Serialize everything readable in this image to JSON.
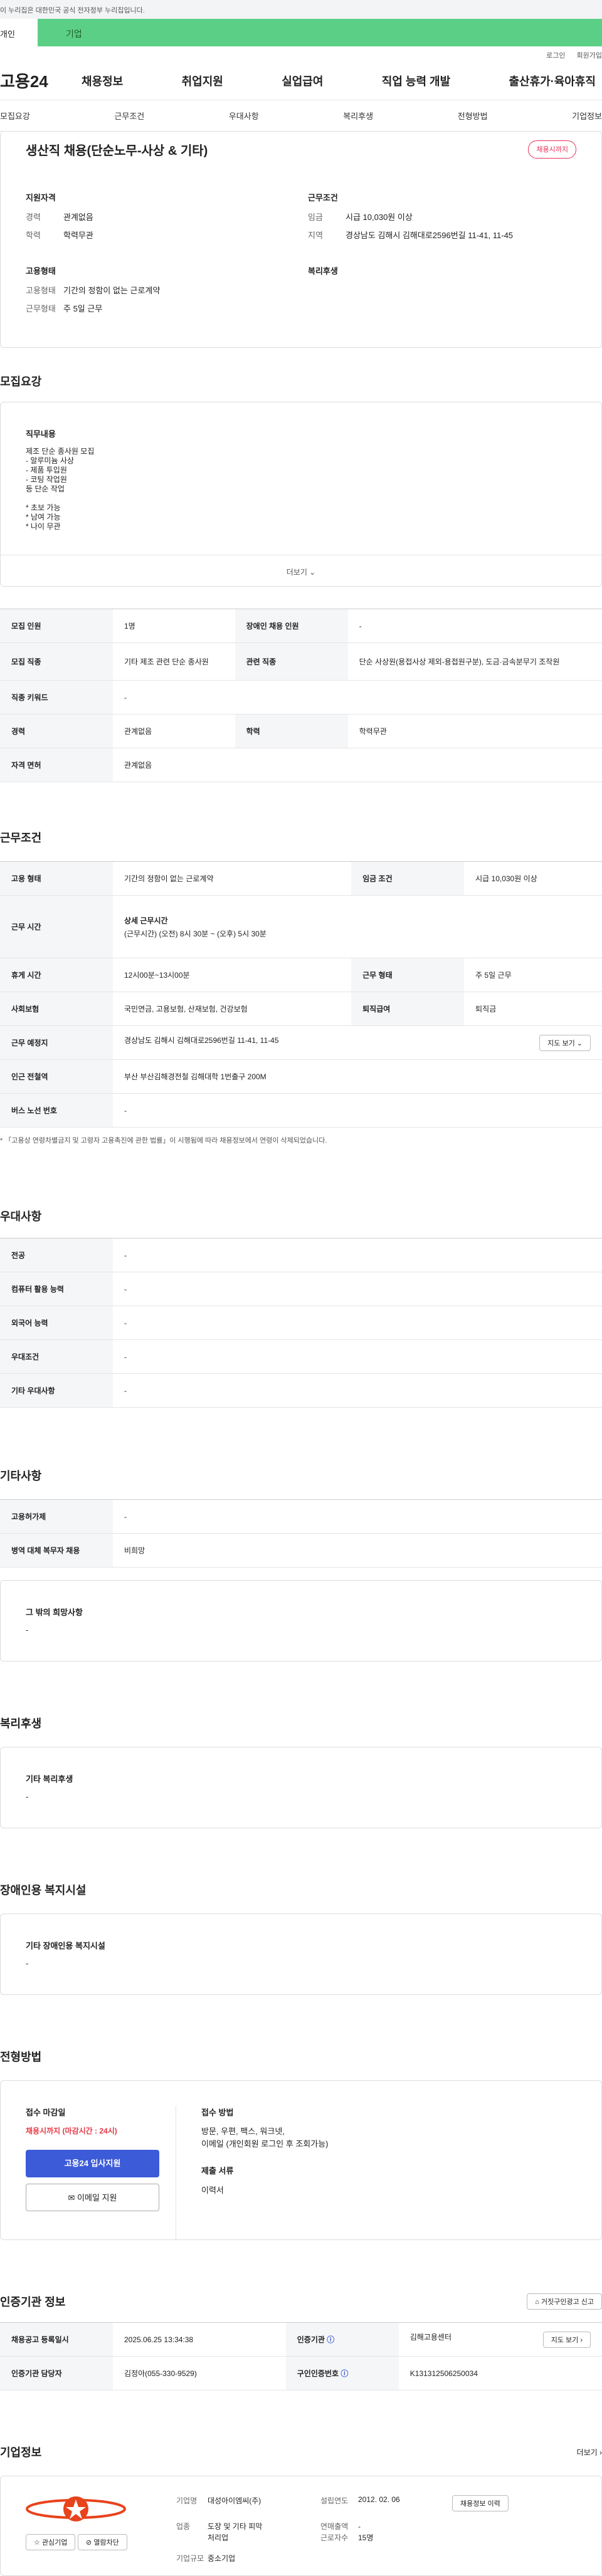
{
  "gov_banner": "이 누리집은 대한민국 공식 전자정부 누리집입니다.",
  "top_tabs": [
    "개인",
    "기업"
  ],
  "util": [
    "로그인",
    "회원가입"
  ],
  "logo": "고용24",
  "gnb": [
    "채용정보",
    "취업지원",
    "실업급여",
    "직업 능력 개발",
    "출산휴가·육아휴직"
  ],
  "subtabs": [
    "모집요강",
    "근무조건",
    "우대사항",
    "복리후생",
    "전형방법",
    "기업정보"
  ],
  "title": "생산직 채용(단순노무-사상 & 기타)",
  "status_badge": "채용시까지",
  "summary": {
    "qual_title": "지원자격",
    "career_k": "경력",
    "career_v": "관계없음",
    "edu_k": "학력",
    "edu_v": "학력무관",
    "cond_title": "근무조건",
    "wage_k": "임금",
    "wage_v": "시급 10,030원 이상",
    "region_k": "지역",
    "region_v": "경상남도 김해시 김해대로2596번길 11-41, 11-45",
    "emp_title": "고용형태",
    "emptype_k": "고용형태",
    "emptype_v": "기간의 정함이 없는 근로계약",
    "worktype_k": "근무형태",
    "worktype_v": "주 5일 근무",
    "welfare_title": "복리후생"
  },
  "recruit": {
    "heading": "모집요강",
    "duty_title": "직무내용",
    "duty_lines": [
      "제조 단순 종사원 모집",
      "- 알루미늄 사상",
      "- 제품 투입원",
      "- 코팅 작업원",
      "등 단순 작업",
      "",
      "* 초보 가능",
      "* 남여 가능",
      "* 나이 무관"
    ],
    "more": "더보기",
    "rows": [
      [
        "모집 인원",
        "1명",
        "장애인 채용 인원",
        "-"
      ],
      [
        "모집 직종",
        "기타 제조 관련 단순 종사원",
        "관련 직종",
        "단순 사상원(용접사상 제외-용접원구분), 도금·금속분무기 조작원"
      ],
      [
        "직종 키워드",
        "-"
      ],
      [
        "경력",
        "관계없음",
        "학력",
        "학력무관"
      ],
      [
        "자격 면허",
        "관계없음"
      ]
    ]
  },
  "condition": {
    "heading": "근무조건",
    "emptype_k": "고용 형태",
    "emptype_v": "기간의 정함이 없는 근로계약",
    "wagecond_k": "임금 조건",
    "wagecond_v": "시급 10,030원 이상",
    "worktime_k": "근무 시간",
    "worktime_title": "상세 근무시간",
    "worktime_v": "(근무시간) (오전) 8시 30분 ~ (오후) 5시 30분",
    "break_k": "휴게 시간",
    "break_v": "12시00분~13시00분",
    "form_k": "근무 형태",
    "form_v": "주 5일 근무",
    "ins_k": "사회보험",
    "ins_v": "국민연금, 고용보험, 산재보험, 건강보험",
    "sev_k": "퇴직급여",
    "sev_v": "퇴직금",
    "place_k": "근무 예정지",
    "place_v": "경상남도 김해시 김해대로2596번길 11-41, 11-45",
    "map_btn": "지도 보기",
    "subway_k": "인근 전철역",
    "subway_v": "부산 부산김해경전철 김해대학 1번출구 200M",
    "bus_k": "버스 노선 번호",
    "bus_v": "-",
    "note": "「고용상 연령차별금지 및 고령자 고용촉진에 관한 법률」이 시행됨에 따라 채용정보에서 연령이 삭제되었습니다."
  },
  "pref": {
    "heading": "우대사항",
    "rows": [
      [
        "전공",
        "-"
      ],
      [
        "컴퓨터 활용 능력",
        "-"
      ],
      [
        "외국어 능력",
        "-"
      ],
      [
        "우대조건",
        "-"
      ],
      [
        "기타 우대사항",
        "-"
      ]
    ]
  },
  "etc": {
    "heading": "기타사항",
    "rows": [
      [
        "고용허가제",
        "-"
      ],
      [
        "병역 대체 복무자 채용",
        "비희망"
      ]
    ],
    "box_title": "그 밖의 희망사항",
    "box_v": "-"
  },
  "welfare": {
    "heading": "복리후생",
    "box_title": "기타 복리후생",
    "box_v": "-"
  },
  "disabled": {
    "heading": "장애인용 복지시설",
    "box_title": "기타 장애인용 복지시설",
    "box_v": "-"
  },
  "process": {
    "heading": "전형방법",
    "deadline_title": "접수 마감일",
    "deadline_v": "채용시까지 (마감시간 : 24시)",
    "apply_btn": "고용24 입사지원",
    "email_btn": "이메일 지원",
    "method_title": "접수 방법",
    "method_v1": "방문, 우편, 팩스, 워크넷,",
    "method_v2": "이메일 (개인회원 로그인 후 조회가능)",
    "docs_title": "제출 서류",
    "docs_v": "이력서"
  },
  "agency": {
    "heading": "인증기관 정보",
    "report_btn": "거짓구인광고 신고",
    "reg_k": "채용공고 등록일시",
    "reg_v": "2025.06.25 13:34:38",
    "agency_k": "인증기관",
    "agency_v": "김해고용센터",
    "map_btn": "지도 보기",
    "mgr_k": "인증기관 담당자",
    "mgr_v": "김정아(055-330-9529)",
    "num_k": "구인인증번호",
    "num_v": "K131312506250034"
  },
  "company": {
    "heading": "기업정보",
    "more": "더보기",
    "fav_btn": "관심기업",
    "block_btn": "열람차단",
    "name_k": "기업명",
    "name_v": "대성아이엠씨(주)",
    "founded_k": "설립연도",
    "founded_v": "2012. 02. 06",
    "status_btn": "채용정보 이력",
    "industry_k": "업종",
    "industry_v1": "도장 및 기타 피막",
    "industry_v2": "처리업",
    "sales_k": "연매출액",
    "sales_v": "-",
    "employees_k": "근로자수",
    "employees_v": "15명",
    "size_k": "기업규모",
    "size_v": "중소기업"
  },
  "colors": {
    "accent_green": "#5ccf86",
    "primary_blue": "#3c5bd9",
    "pink": "#e6335a",
    "deadline_red": "#e63946"
  }
}
